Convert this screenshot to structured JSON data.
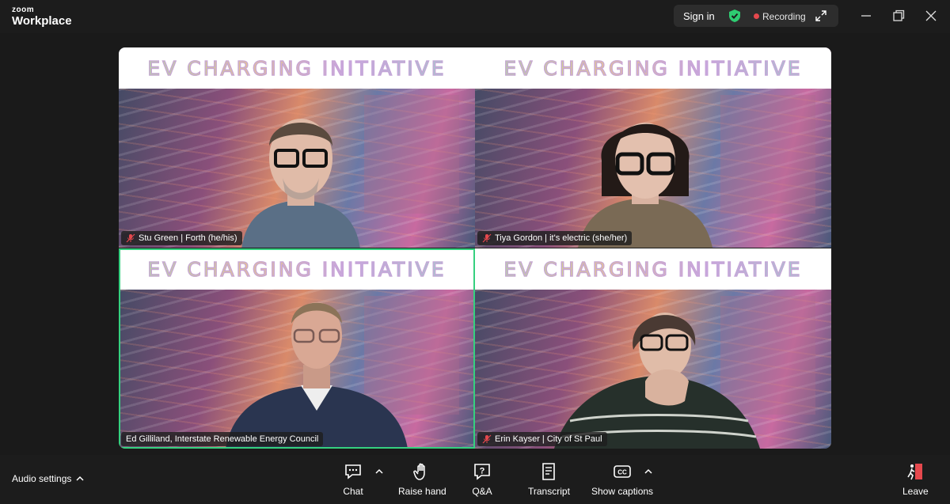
{
  "app": {
    "brand_small": "zoom",
    "brand_big": "Workplace"
  },
  "header": {
    "sign_in": "Sign in",
    "recording": "Recording",
    "colors": {
      "shield": "#2ecc71",
      "recording_dot": "#e5484d"
    }
  },
  "meeting": {
    "banner_text": "EV CHARGING INITIATIVE",
    "tiles": [
      {
        "name": "Stu Green | Forth (he/his)",
        "muted": true,
        "active": false
      },
      {
        "name": "Tiya Gordon | it's electric (she/her)",
        "muted": true,
        "active": false
      },
      {
        "name": "Ed Gilliland, Interstate Renewable Energy Council",
        "muted": false,
        "active": true
      },
      {
        "name": "Erin Kayser | City of St Paul",
        "muted": true,
        "active": false
      }
    ],
    "active_speaker_color": "#35d07f"
  },
  "toolbar": {
    "audio_settings": "Audio settings",
    "chat": "Chat",
    "raise_hand": "Raise hand",
    "qa": "Q&A",
    "transcript": "Transcript",
    "show_captions": "Show captions",
    "leave": "Leave"
  }
}
